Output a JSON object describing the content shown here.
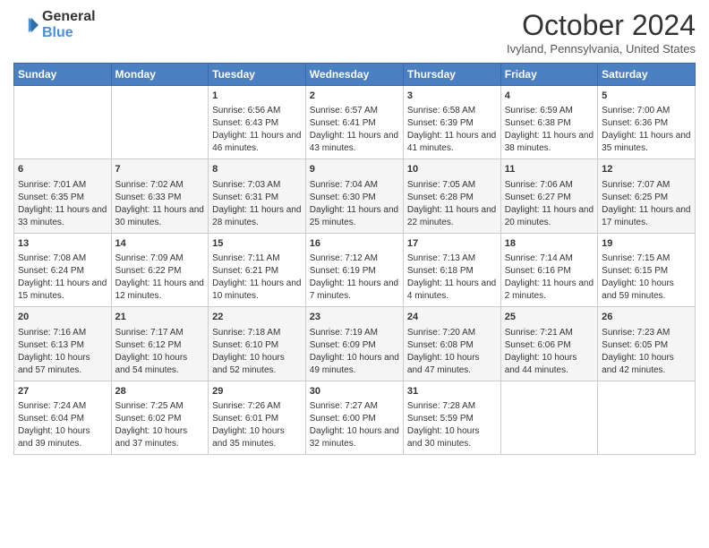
{
  "header": {
    "logo_line1": "General",
    "logo_line2": "Blue",
    "month": "October 2024",
    "location": "Ivyland, Pennsylvania, United States"
  },
  "weekdays": [
    "Sunday",
    "Monday",
    "Tuesday",
    "Wednesday",
    "Thursday",
    "Friday",
    "Saturday"
  ],
  "weeks": [
    [
      {
        "day": "",
        "info": ""
      },
      {
        "day": "",
        "info": ""
      },
      {
        "day": "1",
        "info": "Sunrise: 6:56 AM\nSunset: 6:43 PM\nDaylight: 11 hours and 46 minutes."
      },
      {
        "day": "2",
        "info": "Sunrise: 6:57 AM\nSunset: 6:41 PM\nDaylight: 11 hours and 43 minutes."
      },
      {
        "day": "3",
        "info": "Sunrise: 6:58 AM\nSunset: 6:39 PM\nDaylight: 11 hours and 41 minutes."
      },
      {
        "day": "4",
        "info": "Sunrise: 6:59 AM\nSunset: 6:38 PM\nDaylight: 11 hours and 38 minutes."
      },
      {
        "day": "5",
        "info": "Sunrise: 7:00 AM\nSunset: 6:36 PM\nDaylight: 11 hours and 35 minutes."
      }
    ],
    [
      {
        "day": "6",
        "info": "Sunrise: 7:01 AM\nSunset: 6:35 PM\nDaylight: 11 hours and 33 minutes."
      },
      {
        "day": "7",
        "info": "Sunrise: 7:02 AM\nSunset: 6:33 PM\nDaylight: 11 hours and 30 minutes."
      },
      {
        "day": "8",
        "info": "Sunrise: 7:03 AM\nSunset: 6:31 PM\nDaylight: 11 hours and 28 minutes."
      },
      {
        "day": "9",
        "info": "Sunrise: 7:04 AM\nSunset: 6:30 PM\nDaylight: 11 hours and 25 minutes."
      },
      {
        "day": "10",
        "info": "Sunrise: 7:05 AM\nSunset: 6:28 PM\nDaylight: 11 hours and 22 minutes."
      },
      {
        "day": "11",
        "info": "Sunrise: 7:06 AM\nSunset: 6:27 PM\nDaylight: 11 hours and 20 minutes."
      },
      {
        "day": "12",
        "info": "Sunrise: 7:07 AM\nSunset: 6:25 PM\nDaylight: 11 hours and 17 minutes."
      }
    ],
    [
      {
        "day": "13",
        "info": "Sunrise: 7:08 AM\nSunset: 6:24 PM\nDaylight: 11 hours and 15 minutes."
      },
      {
        "day": "14",
        "info": "Sunrise: 7:09 AM\nSunset: 6:22 PM\nDaylight: 11 hours and 12 minutes."
      },
      {
        "day": "15",
        "info": "Sunrise: 7:11 AM\nSunset: 6:21 PM\nDaylight: 11 hours and 10 minutes."
      },
      {
        "day": "16",
        "info": "Sunrise: 7:12 AM\nSunset: 6:19 PM\nDaylight: 11 hours and 7 minutes."
      },
      {
        "day": "17",
        "info": "Sunrise: 7:13 AM\nSunset: 6:18 PM\nDaylight: 11 hours and 4 minutes."
      },
      {
        "day": "18",
        "info": "Sunrise: 7:14 AM\nSunset: 6:16 PM\nDaylight: 11 hours and 2 minutes."
      },
      {
        "day": "19",
        "info": "Sunrise: 7:15 AM\nSunset: 6:15 PM\nDaylight: 10 hours and 59 minutes."
      }
    ],
    [
      {
        "day": "20",
        "info": "Sunrise: 7:16 AM\nSunset: 6:13 PM\nDaylight: 10 hours and 57 minutes."
      },
      {
        "day": "21",
        "info": "Sunrise: 7:17 AM\nSunset: 6:12 PM\nDaylight: 10 hours and 54 minutes."
      },
      {
        "day": "22",
        "info": "Sunrise: 7:18 AM\nSunset: 6:10 PM\nDaylight: 10 hours and 52 minutes."
      },
      {
        "day": "23",
        "info": "Sunrise: 7:19 AM\nSunset: 6:09 PM\nDaylight: 10 hours and 49 minutes."
      },
      {
        "day": "24",
        "info": "Sunrise: 7:20 AM\nSunset: 6:08 PM\nDaylight: 10 hours and 47 minutes."
      },
      {
        "day": "25",
        "info": "Sunrise: 7:21 AM\nSunset: 6:06 PM\nDaylight: 10 hours and 44 minutes."
      },
      {
        "day": "26",
        "info": "Sunrise: 7:23 AM\nSunset: 6:05 PM\nDaylight: 10 hours and 42 minutes."
      }
    ],
    [
      {
        "day": "27",
        "info": "Sunrise: 7:24 AM\nSunset: 6:04 PM\nDaylight: 10 hours and 39 minutes."
      },
      {
        "day": "28",
        "info": "Sunrise: 7:25 AM\nSunset: 6:02 PM\nDaylight: 10 hours and 37 minutes."
      },
      {
        "day": "29",
        "info": "Sunrise: 7:26 AM\nSunset: 6:01 PM\nDaylight: 10 hours and 35 minutes."
      },
      {
        "day": "30",
        "info": "Sunrise: 7:27 AM\nSunset: 6:00 PM\nDaylight: 10 hours and 32 minutes."
      },
      {
        "day": "31",
        "info": "Sunrise: 7:28 AM\nSunset: 5:59 PM\nDaylight: 10 hours and 30 minutes."
      },
      {
        "day": "",
        "info": ""
      },
      {
        "day": "",
        "info": ""
      }
    ]
  ]
}
